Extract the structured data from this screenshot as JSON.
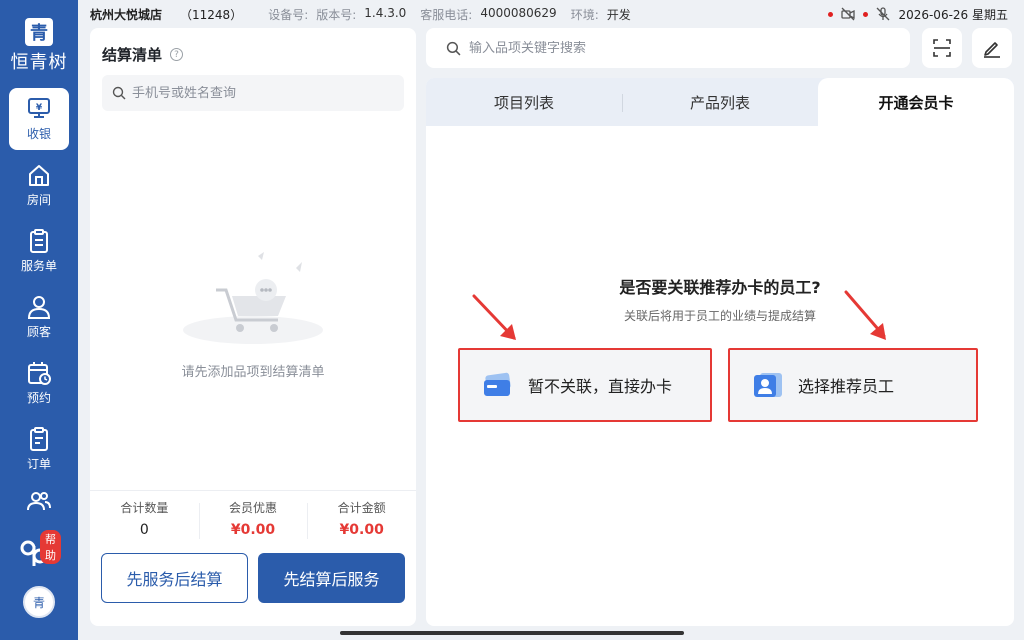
{
  "status_bar": {
    "store_name": "杭州大悦城店",
    "store_id": "（11248）",
    "device_label": "设备号:",
    "version_label": "版本号:",
    "version": "1.4.3.0",
    "service_phone_label": "客服电话:",
    "service_phone": "4000080629",
    "env_label": "环境:",
    "env": "开发",
    "datetime": "2026-06-26 星期五"
  },
  "sidebar": {
    "logo_char": "青",
    "brand": "恒青树",
    "items": [
      {
        "label": "收银",
        "icon": "cash-register-icon",
        "active": true
      },
      {
        "label": "房间",
        "icon": "home-icon"
      },
      {
        "label": "服务单",
        "icon": "clipboard-icon"
      },
      {
        "label": "顾客",
        "icon": "user-icon"
      },
      {
        "label": "预约",
        "icon": "calendar-clock-icon"
      },
      {
        "label": "订单",
        "icon": "order-icon"
      }
    ],
    "help_badge": "帮助",
    "avatar_text": "青"
  },
  "checkout": {
    "title": "结算清单",
    "search_placeholder": "手机号或姓名查询",
    "empty_text": "请先添加品项到结算清单",
    "totals": [
      {
        "label": "合计数量",
        "value": "0"
      },
      {
        "label": "会员优惠",
        "value": "¥0.00"
      },
      {
        "label": "合计金额",
        "value": "¥0.00"
      }
    ],
    "btn_service_first": "先服务后结算",
    "btn_pay_first": "先结算后服务"
  },
  "search": {
    "placeholder": "输入品项关键字搜索"
  },
  "tabs": [
    {
      "label": "项目列表"
    },
    {
      "label": "产品列表"
    },
    {
      "label": "开通会员卡",
      "active": true
    }
  ],
  "member_card": {
    "question": "是否要关联推荐办卡的员工?",
    "subtitle": "关联后将用于员工的业绩与提成结算",
    "option_skip": "暂不关联，直接办卡",
    "option_select": "选择推荐员工"
  },
  "colors": {
    "brand_blue": "#2b5cab",
    "highlight_red": "#e53935"
  }
}
